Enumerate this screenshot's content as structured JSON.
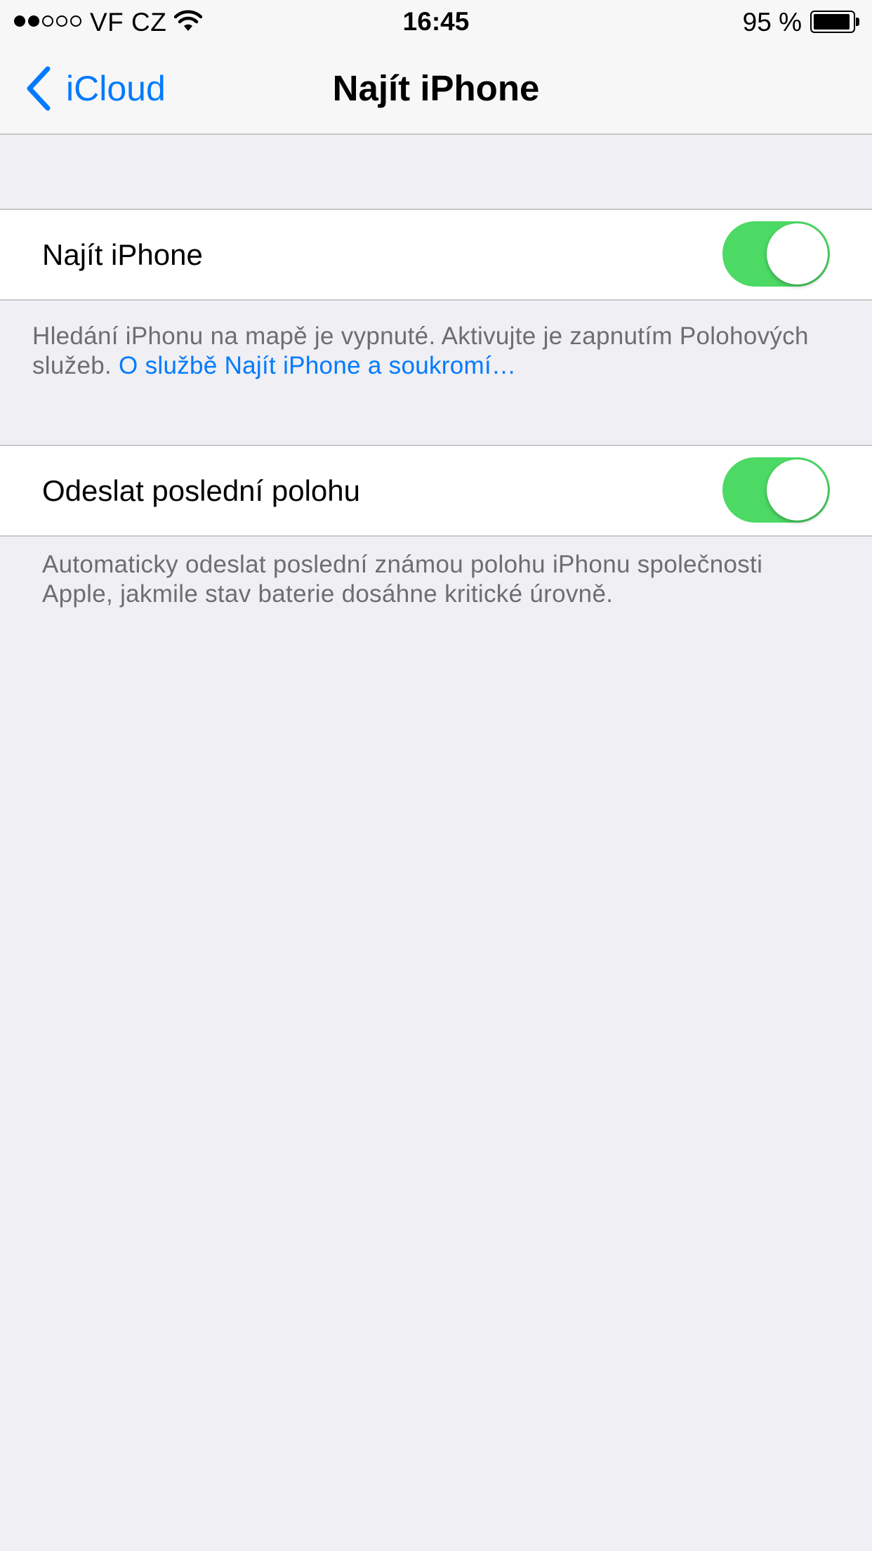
{
  "status_bar": {
    "signal_filled": 2,
    "signal_total": 5,
    "carrier": "VF CZ",
    "time": "16:45",
    "battery_percent_label": "95 %",
    "battery_level": 0.95,
    "icons": [
      "signal-dots-icon",
      "wifi-icon",
      "battery-icon"
    ]
  },
  "nav": {
    "back_label": "iCloud",
    "title": "Najít iPhone",
    "back_icon": "chevron-left-icon"
  },
  "settings": {
    "find_iphone": {
      "label": "Najít iPhone",
      "enabled": true,
      "footer_text": "Hledání iPhonu na mapě je vypnuté. Aktivujte je zapnutím Polohových služeb.",
      "footer_link": "O službě Najít iPhone a soukromí…"
    },
    "send_last_location": {
      "label": "Odeslat poslední polohu",
      "enabled": true,
      "footer_text": "Automaticky odeslat poslední známou polohu iPhonu společnosti Apple, jakmile stav baterie dosáhne kritické úrovně."
    }
  },
  "colors": {
    "accent": "#007aff",
    "toggle_on": "#4cd964",
    "background": "#efeff4",
    "footer_text": "#6d6d72",
    "separator": "#c8c7cc"
  }
}
